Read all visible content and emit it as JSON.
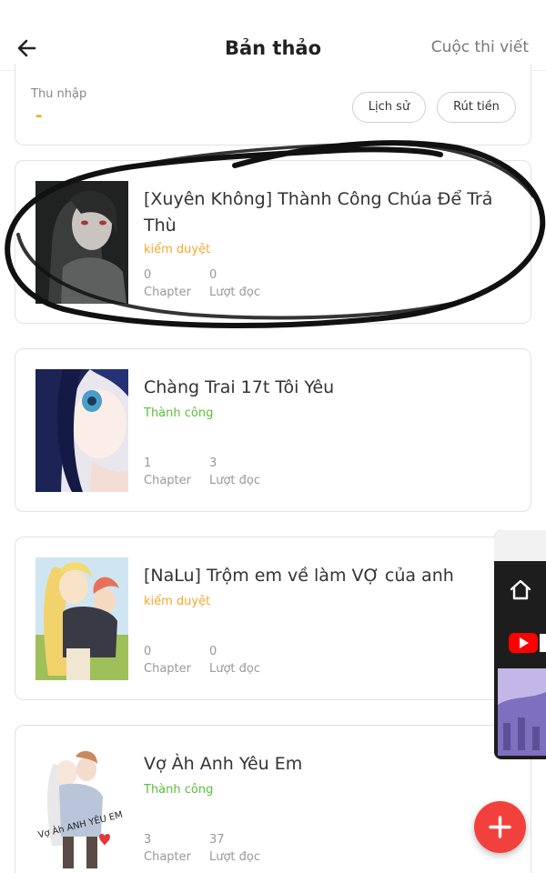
{
  "header": {
    "title": "Bản thảo",
    "contest_link": "Cuộc thi viết",
    "back_icon": "arrow-left-icon"
  },
  "income": {
    "label": "Thu nhập",
    "value": "-",
    "history_button": "Lịch sử",
    "withdraw_button": "Rút tiền"
  },
  "stories": [
    {
      "title": "[Xuyên Không] Thành Công Chúa Để Trả Thù",
      "status": "kiểm duyệt",
      "chapters": "0",
      "chapter_label": "Chapter",
      "reads": "0",
      "reads_label": "Lượt đọc"
    },
    {
      "title": "Chàng Trai 17t Tôi Yêu",
      "status": "Thành công",
      "chapters": "1",
      "chapter_label": "Chapter",
      "reads": "3",
      "reads_label": "Lượt đọc"
    },
    {
      "title": "[NaLu] Trộm em về làm VỢ của anh",
      "status": "kiểm duyệt",
      "chapters": "0",
      "chapter_label": "Chapter",
      "reads": "0",
      "reads_label": "Lượt đọc"
    },
    {
      "title": "Vợ Àh Anh Yêu Em",
      "status": "Thành công",
      "chapters": "3",
      "chapter_label": "Chapter",
      "reads": "37",
      "reads_label": "Lượt đọc",
      "cover_text": "Vợ Àh ANH YÊU EM"
    }
  ],
  "colors": {
    "pending": "#f0a92e",
    "success": "#5cbf3a",
    "accent": "#f2413d",
    "income_value": "#f5a623"
  },
  "side_panel": {
    "home_icon": "home-icon",
    "video_icon": "youtube-icon"
  },
  "fab": {
    "label": "+",
    "icon": "plus-icon"
  }
}
